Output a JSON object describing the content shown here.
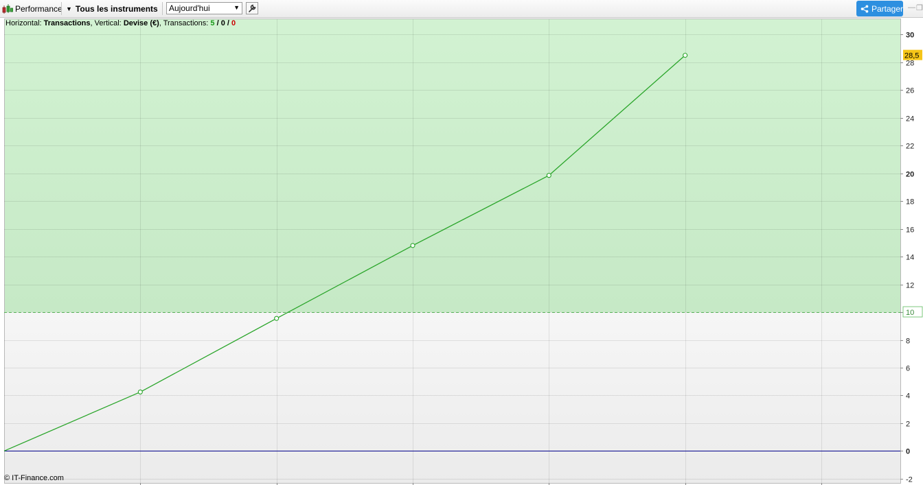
{
  "toolbar": {
    "performance_label": "Performance",
    "instruments_label": "Tous les instruments",
    "period_value": "Aujourd'hui",
    "share_label": "Partager"
  },
  "info": {
    "horizontal_label": "Horizontal:",
    "horizontal_value": "Transactions",
    "vertical_label": ", Vertical:",
    "vertical_value": "Devise (€)",
    "transactions_label": ", Transactions:",
    "tx_win": "5",
    "tx_sep1": " / ",
    "tx_neutral": "0",
    "tx_sep2": " / ",
    "tx_loss": "0"
  },
  "copyright": "© IT-Finance.com",
  "chart_data": {
    "type": "line",
    "x": [
      0,
      1,
      2,
      3,
      4,
      5
    ],
    "series": [
      {
        "values": [
          0,
          4.25,
          9.55,
          14.8,
          19.85,
          28.5
        ]
      }
    ],
    "ylim": [
      -2.3,
      31.1
    ],
    "xlim": [
      0,
      6.58
    ],
    "y_ticks": [
      "-2",
      "0",
      "2",
      "4",
      "6",
      "8",
      "10",
      "12",
      "14",
      "16",
      "18",
      "20",
      "22",
      "24",
      "26",
      "28",
      "30"
    ],
    "y_ticks_bold": [
      "0",
      "10",
      "20",
      "30"
    ],
    "threshold_value": 10,
    "threshold_label": "10",
    "last_value_label": "28,5",
    "zero_line": 0,
    "grid": true,
    "colors": {
      "line": "#2aa52a",
      "zone_above": "#cdefcd",
      "zone_below": "#f1f1f1",
      "zero_line": "#00008b",
      "last_value_badge": "#f5c518",
      "threshold_border": "#7cc97c"
    }
  }
}
